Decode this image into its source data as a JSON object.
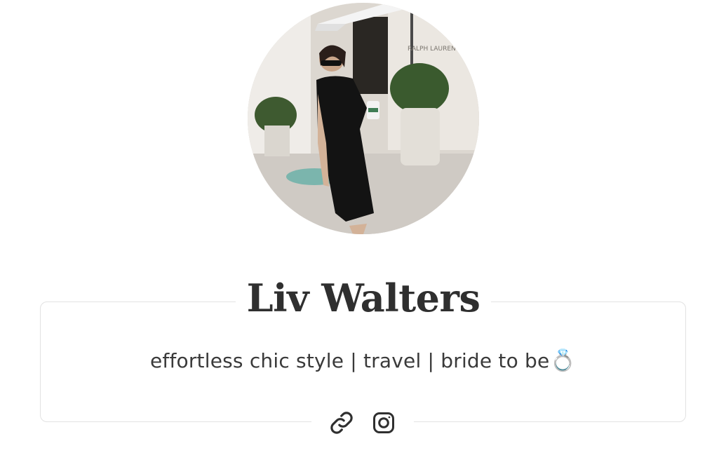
{
  "profile": {
    "name": "Liv Walters",
    "bio_text": "effortless chic style | travel | bride to be",
    "bio_emoji": "💍",
    "avatar_alt": "profile photo",
    "storefront_text": "RALPH LAUREN"
  },
  "social_links": [
    {
      "icon": "link-icon",
      "label": "Link"
    },
    {
      "icon": "instagram-icon",
      "label": "Instagram"
    }
  ],
  "colors": {
    "text_primary": "#2f2f2f",
    "text_secondary": "#3a3a3a",
    "border": "#e2e2e2",
    "background": "#ffffff"
  }
}
